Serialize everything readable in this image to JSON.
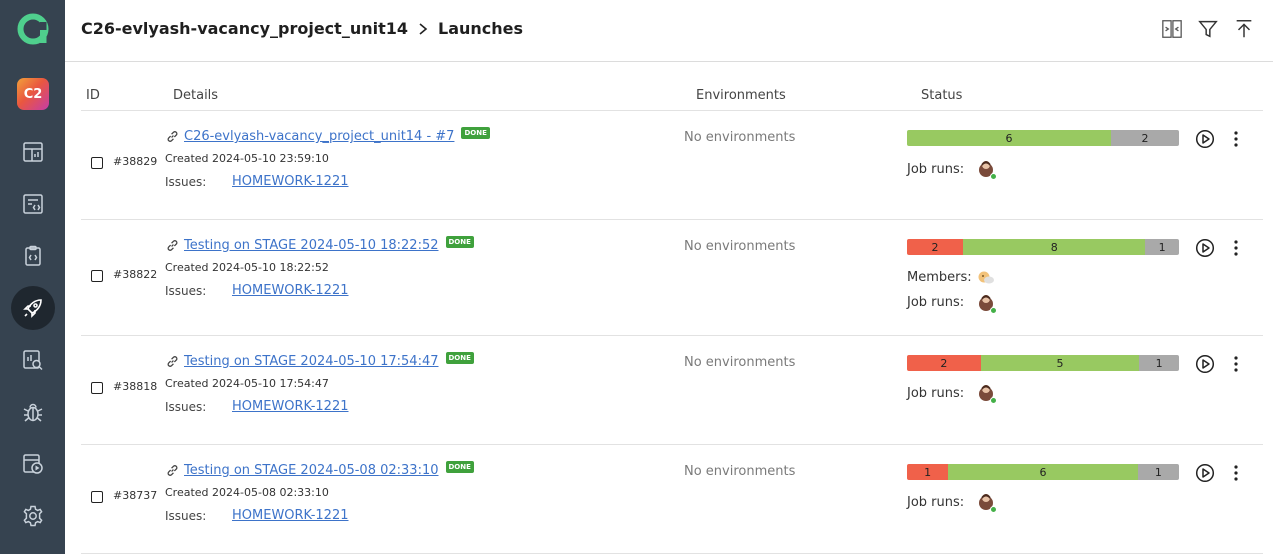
{
  "header": {
    "project": "C26-evlyash-vacancy_project_unit14",
    "page": "Launches"
  },
  "sidebar": {
    "project_badge": "C2",
    "items": [
      {
        "icon": "dashboard-icon"
      },
      {
        "icon": "test-cases-icon"
      },
      {
        "icon": "test-plans-icon"
      },
      {
        "icon": "launches-icon",
        "active": true
      },
      {
        "icon": "analytics-icon"
      },
      {
        "icon": "defects-icon"
      },
      {
        "icon": "jobs-icon"
      },
      {
        "icon": "settings-icon"
      }
    ]
  },
  "columns": {
    "id": "ID",
    "details": "Details",
    "environments": "Environments",
    "status": "Status"
  },
  "labels": {
    "issues": "Issues:",
    "job_runs": "Job runs:",
    "members": "Members:",
    "done": "DONE"
  },
  "launches": [
    {
      "id": "#38829",
      "title": "C26-evlyash-vacancy_project_unit14 - #7",
      "badge": "DONE",
      "created": "Created 2024-05-10 23:59:10",
      "issue": "HOMEWORK-1221",
      "environments": "No environments",
      "stats": {
        "failed": null,
        "passed": 6,
        "skipped": 2
      },
      "members": false
    },
    {
      "id": "#38822",
      "title": "Testing on STAGE 2024-05-10 18:22:52",
      "badge": "DONE",
      "created": "Created 2024-05-10 18:22:52",
      "issue": "HOMEWORK-1221",
      "environments": "No environments",
      "stats": {
        "failed": 2,
        "passed": 8,
        "skipped": 1
      },
      "members": true
    },
    {
      "id": "#38818",
      "title": "Testing on STAGE 2024-05-10 17:54:47",
      "badge": "DONE",
      "created": "Created 2024-05-10 17:54:47",
      "issue": "HOMEWORK-1221",
      "environments": "No environments",
      "stats": {
        "failed": 2,
        "passed": 5,
        "skipped": 1
      },
      "members": false
    },
    {
      "id": "#38737",
      "title": "Testing on STAGE 2024-05-08 02:33:10",
      "badge": "DONE",
      "created": "Created 2024-05-08 02:33:10",
      "issue": "HOMEWORK-1221",
      "environments": "No environments",
      "stats": {
        "failed": 1,
        "passed": 6,
        "skipped": 1
      },
      "members": false
    }
  ],
  "colors": {
    "sidebar": "#364350",
    "failed": "#f0614a",
    "passed": "#98c961",
    "skipped": "#a9a9a9",
    "link": "#3d73c9",
    "badge": "#3fa13c",
    "logo": "#4fcf8d"
  }
}
